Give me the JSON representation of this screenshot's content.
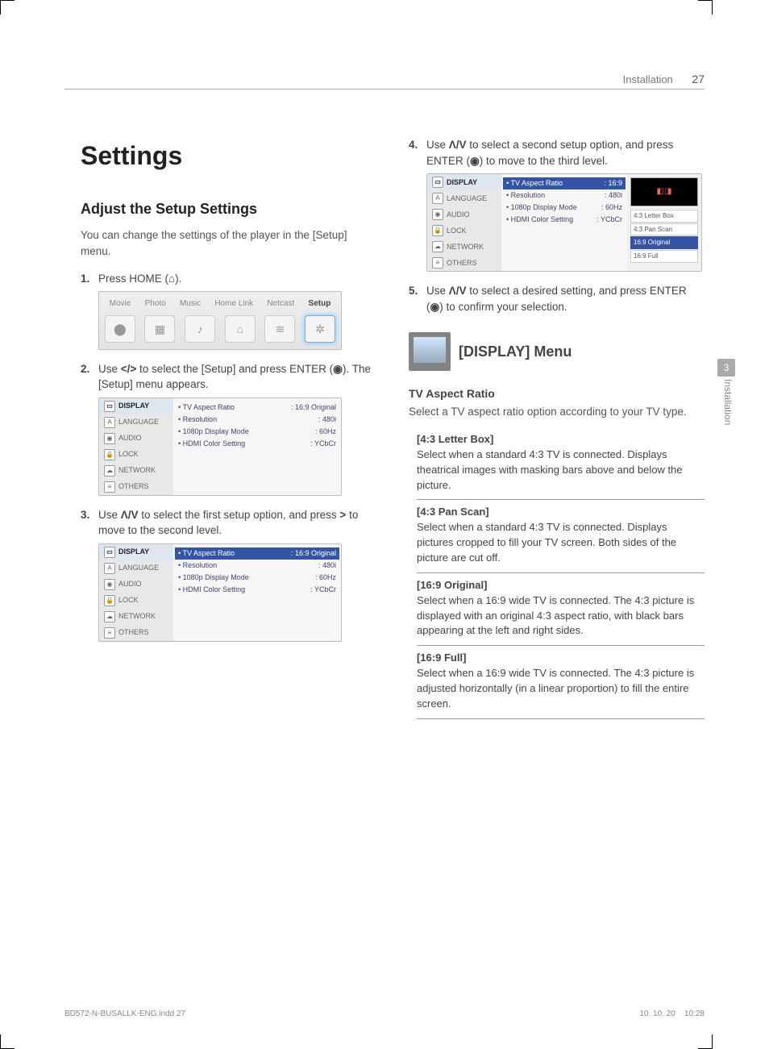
{
  "header": {
    "section": "Installation",
    "page": "27"
  },
  "title": "Settings",
  "subtitle": "Adjust the Setup Settings",
  "intro": "You can change the settings of the player in the [Setup] menu.",
  "steps": {
    "s1": {
      "num": "1.",
      "text_prefix": "Press HOME (",
      "text_suffix": ")."
    },
    "s2": {
      "num": "2.",
      "text_a": "Use ",
      "text_b": " to select the [Setup] and press ENTER (",
      "text_c": "). The [Setup] menu appears."
    },
    "s3": {
      "num": "3.",
      "text_a": "Use ",
      "text_b": " to select the first setup option, and press ",
      "text_c": " to move to the second level."
    },
    "s4": {
      "num": "4.",
      "text_a": "Use ",
      "text_b": " to select a second setup option, and press ENTER (",
      "text_c": ") to move to the third level."
    },
    "s5": {
      "num": "5.",
      "text_a": "Use ",
      "text_b": " to select a desired setting, and press ENTER (",
      "text_c": ") to confirm your selection."
    }
  },
  "symbols": {
    "home": "⌂",
    "lr": "</>",
    "ud": "Λ/V",
    "gt": ">",
    "enter": "◉"
  },
  "home_menu": {
    "tabs": [
      "Movie",
      "Photo",
      "Music",
      "Home Link",
      "Netcast",
      "Setup"
    ],
    "active_index": 5
  },
  "setup_left": {
    "items": [
      "DISPLAY",
      "LANGUAGE",
      "AUDIO",
      "LOCK",
      "NETWORK",
      "OTHERS"
    ]
  },
  "setup_opts": {
    "o1": {
      "label": "• TV Aspect Ratio",
      "val": ": 16:9 Original"
    },
    "o2": {
      "label": "• Resolution",
      "val": ": 480i"
    },
    "o3": {
      "label": "• 1080p Display Mode",
      "val": ": 60Hz"
    },
    "o4": {
      "label": "• HDMI Color Setting",
      "val": ": YCbCr"
    }
  },
  "dropdown_fig": {
    "top": {
      "label": "• TV Aspect Ratio",
      "val": ": 16:9"
    },
    "o2": {
      "label": "• Resolution",
      "val": ": 480i"
    },
    "o3": {
      "label": "• 1080p Display Mode",
      "val": ": 60Hz"
    },
    "o4": {
      "label": "• HDMI Color Setting",
      "val": ": YCbCr"
    },
    "right": [
      "4:3 Letter Box",
      "4:3 Pan Scan",
      "16:9 Original",
      "16:9 Full"
    ],
    "right_sel": 2
  },
  "display_menu": {
    "label": "[DISPLAY] Menu",
    "tv_aspect_title": "TV Aspect Ratio",
    "tv_aspect_desc": "Select a TV aspect ratio option according to your TV type.",
    "ratios": [
      {
        "name": "[4:3 Letter Box]",
        "desc": "Select when a standard 4:3 TV is connected. Displays theatrical images with masking bars above and below the picture."
      },
      {
        "name": "[4:3 Pan Scan]",
        "desc": "Select when a standard 4:3 TV is connected. Displays pictures cropped to fill your TV screen. Both sides of the picture are cut off."
      },
      {
        "name": "[16:9 Original]",
        "desc": "Select when a 16:9 wide TV is connected. The 4:3 picture is displayed with an original 4:3 aspect ratio, with black bars appearing at the left and right sides."
      },
      {
        "name": "[16:9 Full]",
        "desc": "Select when a 16:9 wide TV is connected. The 4:3 picture is adjusted horizontally (in a linear proportion) to fill the entire screen."
      }
    ]
  },
  "side": {
    "chapter": "3",
    "label": "Installation"
  },
  "footer": {
    "left": "BD572-N-BUSALLK-ENG.indd   27",
    "right_date": "10. 10. 20",
    "right_time": "10:28"
  }
}
